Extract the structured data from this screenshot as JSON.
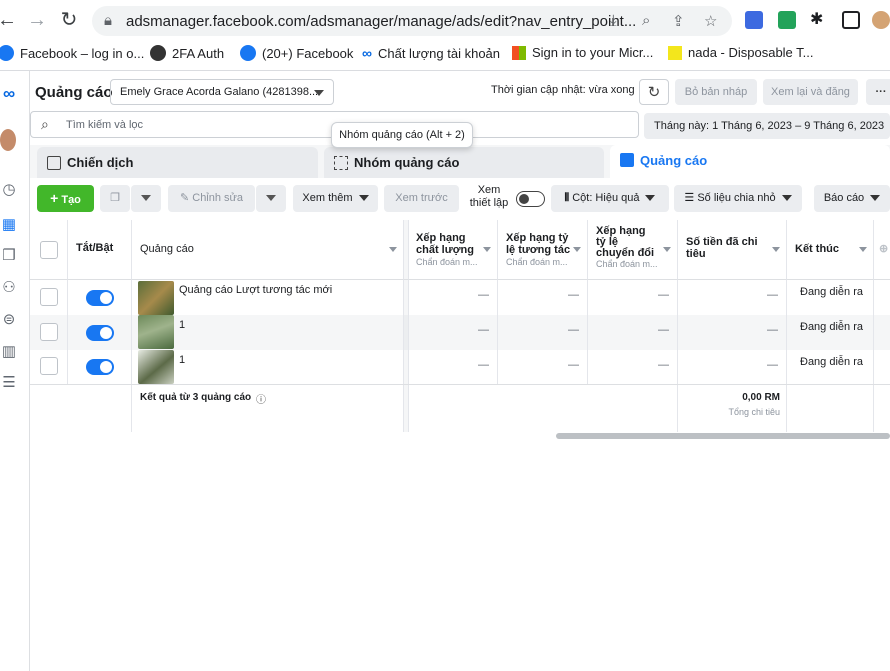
{
  "browser": {
    "url": "adsmanager.facebook.com/adsmanager/manage/ads/edit?nav_entry_point...",
    "bookmarks": [
      {
        "label": "Facebook – log in o..."
      },
      {
        "label": "2FA Auth"
      },
      {
        "label": "(20+) Facebook"
      },
      {
        "label": "Chất lượng tài khoản"
      },
      {
        "label": "Sign in to your Micr..."
      },
      {
        "label": "nada - Disposable T..."
      }
    ]
  },
  "header": {
    "title": "Quảng cáo",
    "account": "Emely Grace Acorda Galano (4281398...",
    "updated": "Thời gian cập nhật: vừa xong",
    "discard_label": "Bỏ bản nháp",
    "review_label": "Xem lại và đăng",
    "more_label": "···"
  },
  "search": {
    "placeholder": "Tìm kiếm và lọc",
    "date_range": "Tháng này: 1 Tháng 6, 2023 – 9 Tháng 6, 2023"
  },
  "tooltip": "Nhóm quảng cáo (Alt + 2)",
  "tabs": [
    {
      "label": "Chiến dịch"
    },
    {
      "label": "Nhóm quảng cáo"
    },
    {
      "label": "Quảng cáo"
    }
  ],
  "toolbar": {
    "create_label": "Tạo",
    "edit_label": "Chỉnh sửa",
    "more_label": "Xem thêm",
    "preview_label": "Xem trước",
    "view_setup_label": "Xem thiết lập",
    "columns_label": "Cột: Hiệu quả",
    "breakdown_label": "Số liệu chia nhỏ",
    "reports_label": "Báo cáo"
  },
  "table": {
    "columns": {
      "toggle": "Tắt/Bật",
      "ad": "Quảng cáo",
      "quality": "Xếp hạng chất lượng",
      "engagement": "Xếp hạng tỷ lệ tương tác",
      "conversion": "Xếp hạng tỷ lệ chuyển đổi",
      "spent": "Số tiền đã chi tiêu",
      "end": "Kết thúc"
    },
    "diag_sub": "Chẩn đoán m...",
    "rows": [
      {
        "name": "Quảng cáo Lượt tương tác mới",
        "quality": "—",
        "engagement": "—",
        "conversion": "—",
        "spent": "—",
        "end": "Đang diễn ra"
      },
      {
        "name": "1",
        "quality": "—",
        "engagement": "—",
        "conversion": "—",
        "spent": "—",
        "end": "Đang diễn ra"
      },
      {
        "name": "1",
        "quality": "—",
        "engagement": "—",
        "conversion": "—",
        "spent": "—",
        "end": "Đang diễn ra"
      }
    ],
    "summary": {
      "label": "Kết quả từ 3 quảng cáo",
      "spent": "0,00 RM",
      "spent_sub": "Tổng chi tiêu"
    }
  },
  "colors": {
    "primary": "#1877f2",
    "create_green": "#42b72a"
  }
}
